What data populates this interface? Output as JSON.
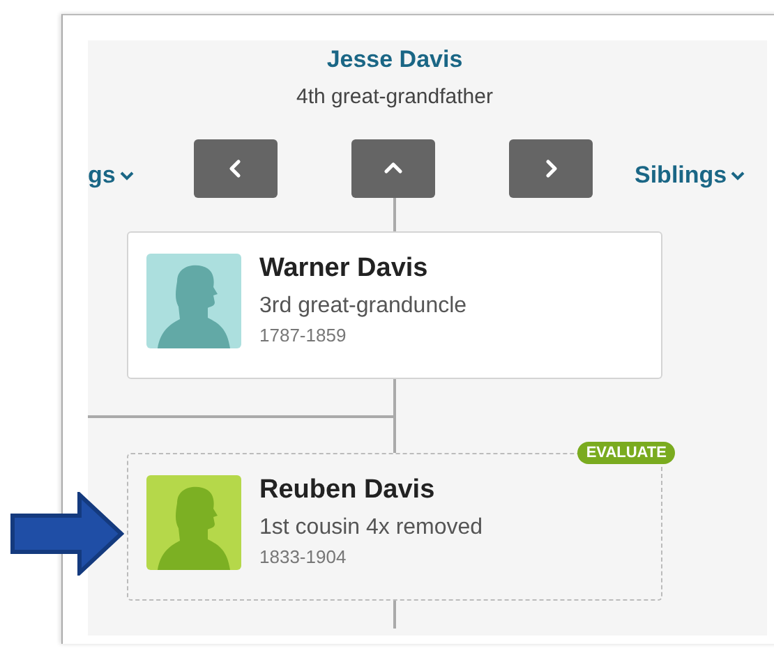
{
  "focus": {
    "name": "Jesse Davis",
    "relation": "4th great-grandfather"
  },
  "nav": {
    "left_link": "gs",
    "right_link": "Siblings",
    "buttons": [
      {
        "kind": "prev"
      },
      {
        "kind": "up"
      },
      {
        "kind": "next"
      }
    ]
  },
  "people": [
    {
      "kind": "confirmed",
      "name": "Warner Davis",
      "relation": "3rd great-granduncle",
      "dates": "1787-1859"
    },
    {
      "kind": "hint",
      "badge": "EVALUATE",
      "name": "Reuben Davis",
      "relation": "1st cousin 4x removed",
      "dates": "1833-1904"
    }
  ]
}
